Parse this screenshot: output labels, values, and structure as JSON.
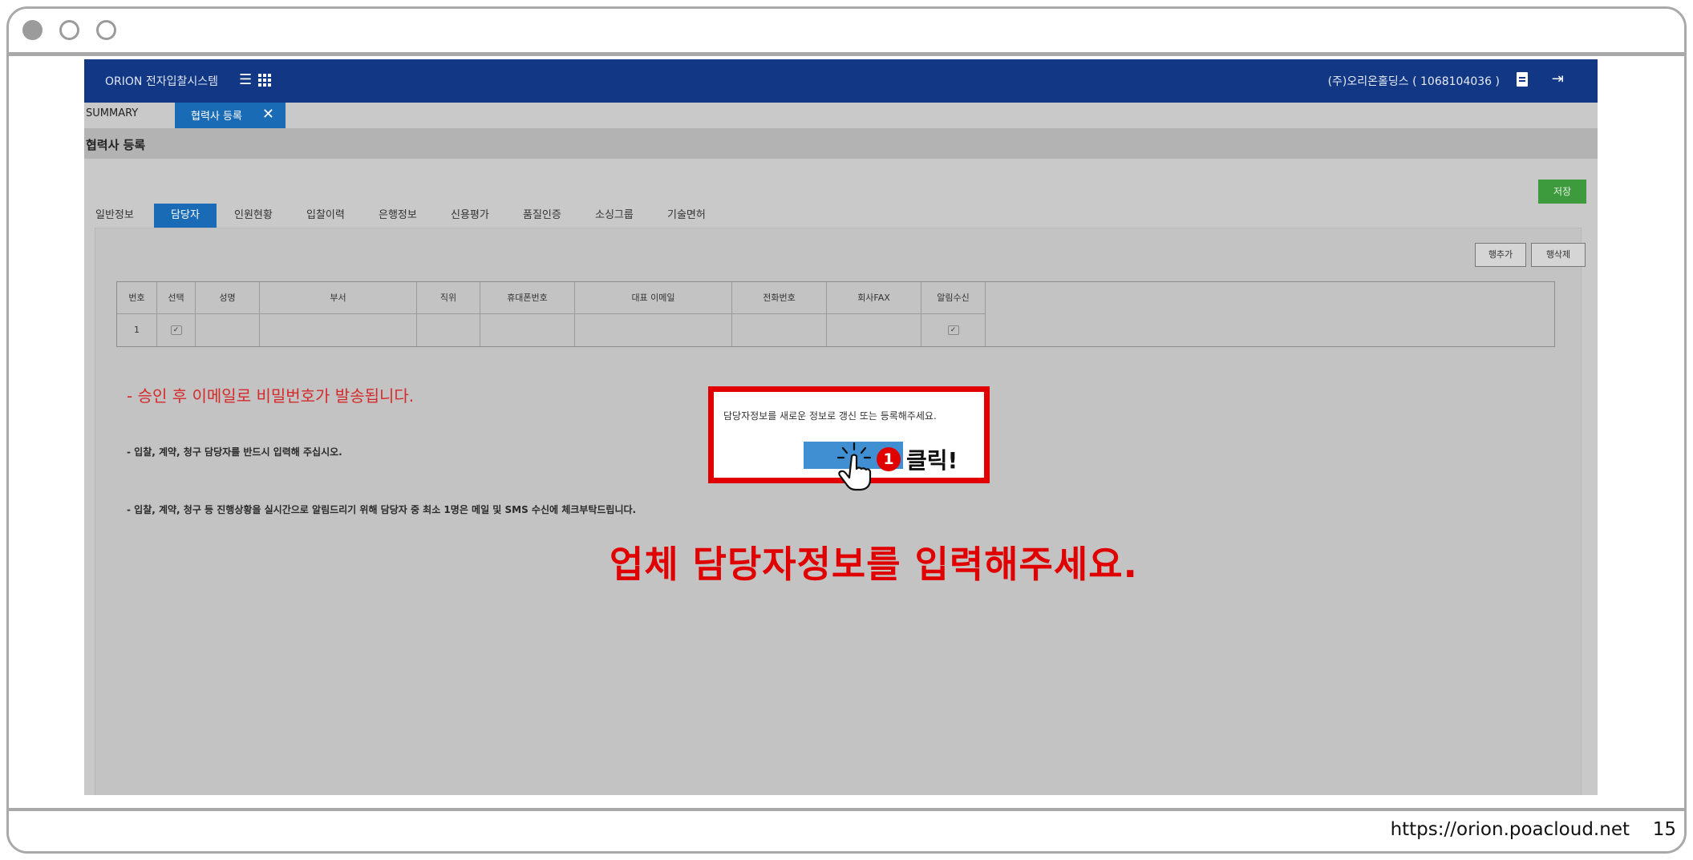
{
  "window": {
    "url": "https://orion.poacloud.net",
    "page_number": "15"
  },
  "header": {
    "brand": "ORION 전자입찰시스템",
    "company": "(주)오리온홀딩스 ( 1068104036 )"
  },
  "tabs": {
    "summary": "SUMMARY",
    "active": "협력사 등록",
    "close": "✕"
  },
  "page": {
    "title": "협력사 등록",
    "save_label": "저장"
  },
  "subtabs": [
    "일반정보",
    "담당자",
    "인원현황",
    "입찰이력",
    "은행정보",
    "신용평가",
    "품질인증",
    "소싱그룹",
    "기술면허"
  ],
  "table_actions": {
    "add_row": "행추가",
    "delete_row": "행삭제"
  },
  "table": {
    "headers": [
      "번호",
      "선택",
      "성명",
      "부서",
      "직위",
      "휴대폰번호",
      "대표 이메일",
      "전화번호",
      "회사FAX",
      "알림수신"
    ],
    "rows": [
      {
        "no": "1",
        "select": "✓",
        "name": "",
        "dept": "",
        "position": "",
        "mobile": "",
        "email": "",
        "phone": "",
        "fax": "",
        "notify": "✓"
      }
    ]
  },
  "notes": {
    "red": "- 승인 후 이메일로 비밀번호가 발송됩니다.",
    "line1": "- 입찰, 계약, 청구 담당자를 반드시 입력해 주십시오.",
    "line2": "- 입찰, 계약, 청구 등 진행상황을 실시간으로 알림드리기 위해 담당자 중 최소 1명은 메일 및 SMS 수신에 체크부탁드립니다."
  },
  "dialog": {
    "message": "담당자정보를 새로운 정보로 갱신 또는 등록해주세요."
  },
  "callout": {
    "badge": "1",
    "label": "클릭!",
    "heading": "업체 담당자정보를 입력해주세요."
  },
  "icons": [
    "menu-icon",
    "grid-icon",
    "document-icon",
    "logout-icon",
    "hand-pointer-icon"
  ],
  "colors": {
    "navbar": "#113785",
    "active_tab": "#1a6bb5",
    "save_button": "#3d9a3d",
    "highlight_red": "#e00000"
  }
}
